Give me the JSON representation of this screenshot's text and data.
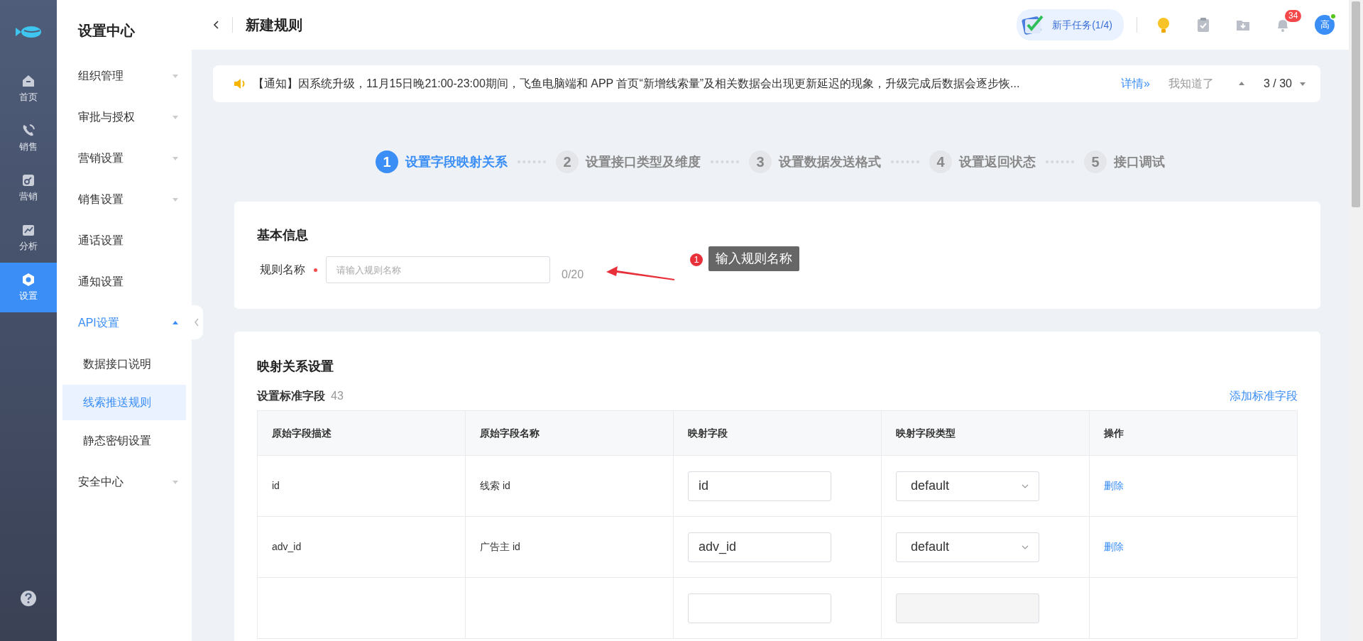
{
  "rail": {
    "items": [
      {
        "label": "首页",
        "kind": "home",
        "selected": false
      },
      {
        "label": "销售",
        "kind": "phone",
        "selected": false
      },
      {
        "label": "营销",
        "kind": "share",
        "selected": false
      },
      {
        "label": "分析",
        "kind": "chart",
        "selected": false
      },
      {
        "label": "设置",
        "kind": "gear",
        "selected": true
      }
    ]
  },
  "sidebar": {
    "title": "设置中心",
    "items": [
      {
        "kind": "group",
        "label": "组织管理",
        "expanded": false,
        "selected": false
      },
      {
        "kind": "group",
        "label": "审批与授权",
        "expanded": false,
        "selected": false
      },
      {
        "kind": "group",
        "label": "营销设置",
        "expanded": false,
        "selected": false
      },
      {
        "kind": "group",
        "label": "销售设置",
        "expanded": false,
        "selected": false
      },
      {
        "kind": "link",
        "label": "通话设置",
        "selected": false
      },
      {
        "kind": "link",
        "label": "通知设置",
        "selected": false
      },
      {
        "kind": "group",
        "label": "API设置",
        "expanded": true,
        "selected": true,
        "children": [
          {
            "label": "数据接口说明",
            "selected": false
          },
          {
            "label": "线索推送规则",
            "selected": true
          },
          {
            "label": "静态密钥设置",
            "selected": false
          }
        ]
      },
      {
        "kind": "group",
        "label": "安全中心",
        "expanded": false,
        "selected": false
      }
    ]
  },
  "header": {
    "title": "新建规则",
    "task_button": "新手任务(1/4)",
    "notification_count": "34",
    "avatar": "高"
  },
  "notice": {
    "text": "【通知】因系统升级，11月15日晚21:00-23:00期间，飞鱼电脑端和 APP 首页“新增线索量”及相关数据会出现更新延迟的现象，升级完成后数据会逐步恢...",
    "details_link": "详情»",
    "dismiss_link": "我知道了",
    "pager": "3 / 30"
  },
  "steps": [
    {
      "number": "1",
      "label": "设置字段映射关系",
      "selected": true
    },
    {
      "number": "2",
      "label": "设置接口类型及维度",
      "selected": false
    },
    {
      "number": "3",
      "label": "设置数据发送格式",
      "selected": false
    },
    {
      "number": "4",
      "label": "设置返回状态",
      "selected": false
    },
    {
      "number": "5",
      "label": "接口调试",
      "selected": false
    }
  ],
  "basic_info": {
    "title": "基本信息",
    "name_label": "规则名称",
    "name_placeholder": "请输入规则名称",
    "counter": "0/20",
    "required": true,
    "annotation": {
      "number": "1",
      "text": "输入规则名称"
    }
  },
  "mapping": {
    "title": "映射关系设置",
    "subtitle": "设置标准字段",
    "count": "43",
    "add_link": "添加标准字段",
    "table": {
      "columns": [
        "原始字段描述",
        "原始字段名称",
        "映射字段",
        "映射字段类型",
        "操作"
      ],
      "rows": [
        {
          "description": "id",
          "name": "线索 id",
          "field": "id",
          "type": "default",
          "type_disabled": false,
          "action": "删除"
        },
        {
          "description": "adv_id",
          "name": "广告主 id",
          "field": "adv_id",
          "type": "default",
          "type_disabled": false,
          "action": "删除"
        },
        {
          "type_disabled": true
        }
      ]
    }
  }
}
